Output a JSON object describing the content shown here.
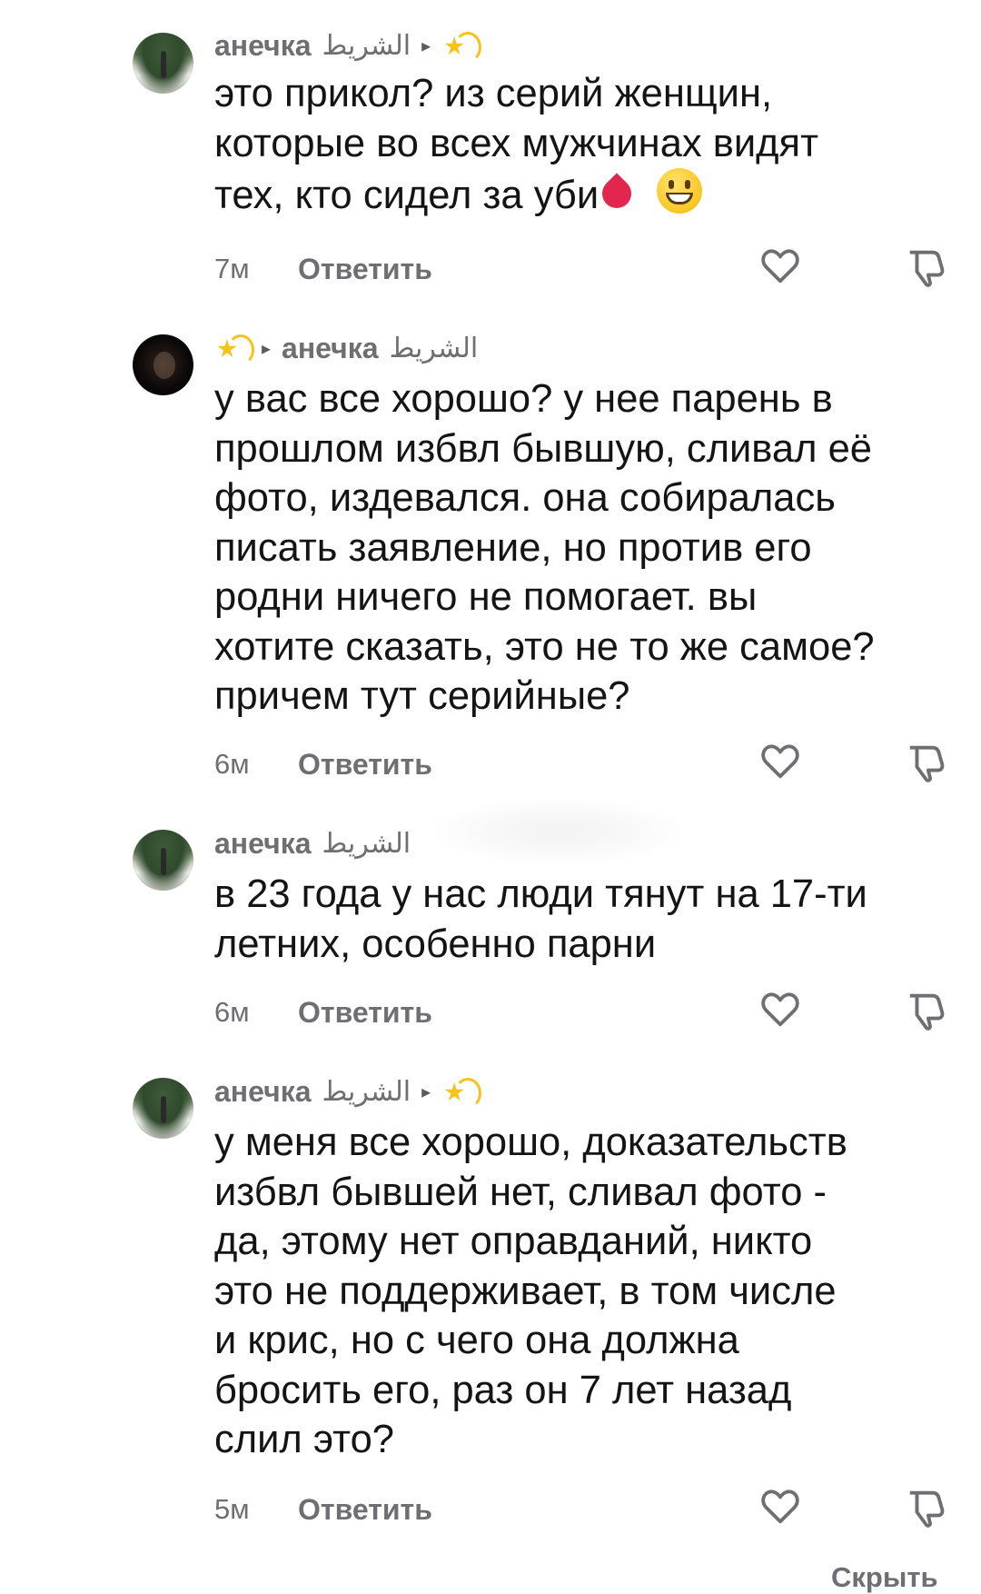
{
  "comments": [
    {
      "author": "анечка",
      "author_tag": "الشريط",
      "reply_to": "",
      "has_reply_arrow": true,
      "text": "это прикол? из серий женщин,\nкоторые во всех мужчинах видят\nтех, кто сидел за уби",
      "time": "7м",
      "reply_label": "Ответить"
    },
    {
      "author": "анечка",
      "author_tag": "الشريط",
      "has_reply_arrow": true,
      "text": "у вас все хорошо? у нее парень в\nпрошлом избвл бывшую, сливал её\nфото, издевался. она собиралась\nписать заявление, но против его\nродни ничего не помогает. вы\nхотите сказать, это не то же самое?\nпричем тут серийные?",
      "time": "6м",
      "reply_label": "Ответить"
    },
    {
      "author": "анечка",
      "author_tag": "الشريط",
      "has_reply_arrow": false,
      "text": "в 23 года у нас люди тянут на 17-ти\nлетних, особенно парни",
      "time": "6м",
      "reply_label": "Ответить"
    },
    {
      "author": "анечка",
      "author_tag": "الشريط",
      "has_reply_arrow": true,
      "text": "у меня все хорошо, доказательств\nизбвл бывшей нет, сливал фото -\nда, этому нет оправданий, никто\nэто не поддерживает, в том числе\nи крис, но с чего она должна\nбросить его, раз он 7 лет назад\nслил это?",
      "time": "5м",
      "reply_label": "Ответить"
    }
  ],
  "footer": {
    "hide_label": "Скрыть"
  },
  "icons": {
    "reply_arrow": "▸",
    "sparkle": "dizzy-star-emoji",
    "like": "heart-outline-icon",
    "dislike": "thumbs-down-outline-icon",
    "blood_drop": "drop-of-blood-emoji",
    "grin": "grinning-face-emoji"
  },
  "colors": {
    "text": "#141414",
    "muted": "#6f6f73",
    "background": "#ffffff"
  }
}
